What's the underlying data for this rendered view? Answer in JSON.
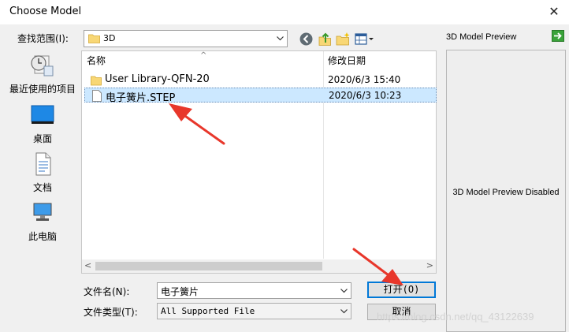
{
  "window": {
    "title": "Choose Model",
    "close_glyph": "✕"
  },
  "lookin": {
    "label": "查找范围(I):",
    "value": "3D"
  },
  "places": [
    {
      "label": "最近使用的项目",
      "icon": "recent-items-icon"
    },
    {
      "label": "桌面",
      "icon": "desktop-icon"
    },
    {
      "label": "文档",
      "icon": "documents-icon"
    },
    {
      "label": "此电脑",
      "icon": "this-pc-icon"
    }
  ],
  "list": {
    "col_name": "名称",
    "col_date": "修改日期",
    "sort_caret": "^",
    "items": [
      {
        "name": "User Library-QFN-20",
        "date": "2020/6/3 15:40",
        "type": "folder"
      },
      {
        "name": "电子簧片.STEP",
        "date": "2020/6/3 10:23",
        "type": "file",
        "selected": true
      }
    ],
    "scroll_left": "<",
    "scroll_right": ">"
  },
  "form": {
    "filename_label": "文件名(N):",
    "filename_value": "电子簧片",
    "filetype_label": "文件类型(T):",
    "filetype_value": "All Supported File",
    "open_label": "打开(O)",
    "cancel_label": "取消"
  },
  "preview": {
    "title": "3D Model Preview",
    "message": "3D Model Preview Disabled"
  },
  "watermark": "https://blog.csdn.net/qq_43122639",
  "colors": {
    "dialog_bg": "#f0f0f0",
    "selection": "#cce8ff",
    "folder": "#f8d775",
    "annotation_arrow": "#e8372b",
    "default_button_border": "#0078d7"
  }
}
